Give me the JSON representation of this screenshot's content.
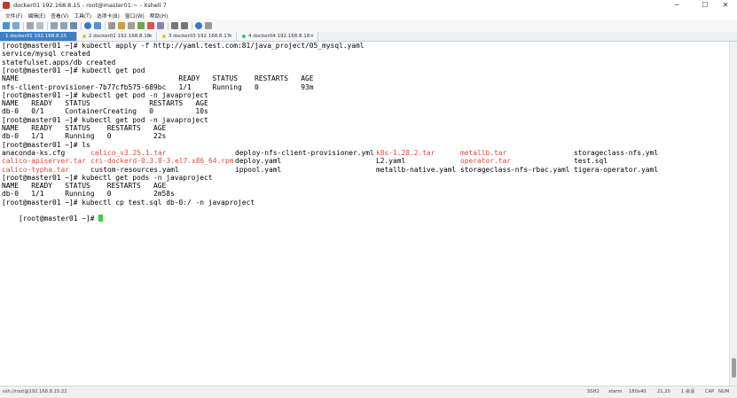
{
  "window": {
    "title": "docker01 192.168.8.15 - root@master01:~ - Xshell 7",
    "minimize": "─",
    "maximize": "☐",
    "close": "✕"
  },
  "menu": [
    "文件(F)",
    "编辑(E)",
    "查看(V)",
    "工具(T)",
    "选项卡(B)",
    "窗口(W)",
    "帮助(H)"
  ],
  "tabs": [
    {
      "label": "1 docker01 192.168.8.15",
      "dot": "#2ecc71"
    },
    {
      "label": "2 docker02 192.168.8.16",
      "dot": "#f1c40f"
    },
    {
      "label": "3 docker03 192.168.8.17",
      "dot": "#f1c40f"
    },
    {
      "label": "4 docker04 192.168.8.18",
      "dot": "#2ecc71"
    }
  ],
  "tab_close": "×",
  "terminal": {
    "lines": [
      "[root@master01 ~]# kubectl apply -f http://yaml.test.com:81/java_project/05_mysql.yaml",
      "service/mysql created",
      "statefulset.apps/db created",
      "[root@master01 ~]# kubectl get pod",
      "NAME                                      READY   STATUS    RESTARTS   AGE",
      "nfs-client-provisioner-7b77cfb575-689bc   1/1     Running   0          93m",
      "[root@master01 ~]# kubectl get pod -n javaproject",
      "NAME   READY   STATUS              RESTARTS   AGE",
      "db-0   0/1     ContainerCreating   0          10s",
      "[root@master01 ~]# kubectl get pod -n javaproject",
      "NAME   READY   STATUS    RESTARTS   AGE",
      "db-0   1/1     Running   0          22s",
      "[root@master01 ~]# ls",
      "",
      "",
      "",
      "[root@master01 ~]# kubectl get pods -n javaproject",
      "NAME   READY   STATUS    RESTARTS   AGE",
      "db-0   1/1     Running   0          2m58s",
      "[root@master01 ~]# kubectl cp test.sql db-0:/ -n javaproject",
      "[root@master01 ~]# "
    ],
    "ls_rows": [
      [
        {
          "text": "anaconda-ks.cfg",
          "red": false
        },
        {
          "text": "calico_v3.25.1.tar",
          "red": true
        },
        {
          "text": "deploy-nfs-client-provisioner.yml",
          "red": false
        },
        {
          "text": "k8s-1.28.2.tar",
          "red": true
        },
        {
          "text": "metallb.tar",
          "red": true
        },
        {
          "text": "storageclass-nfs.yml",
          "red": false
        }
      ],
      [
        {
          "text": "calico-apiserver.tar",
          "red": true
        },
        {
          "text": "cri-dockerd-0.3.8-3.el7.x86_64.rpm",
          "red": true
        },
        {
          "text": "deploy.yaml",
          "red": false
        },
        {
          "text": "L2.yaml",
          "red": false
        },
        {
          "text": "operator.tar",
          "red": true
        },
        {
          "text": "test.sql",
          "red": false
        }
      ],
      [
        {
          "text": "calico-typha.tar",
          "red": true
        },
        {
          "text": "custom-resources.yaml",
          "red": false
        },
        {
          "text": "ippool.yaml",
          "red": false
        },
        {
          "text": "metallb-native.yaml",
          "red": false
        },
        {
          "text": "storageclass-nfs-rbac.yaml",
          "red": false
        },
        {
          "text": "tigera-operator.yaml",
          "red": false
        }
      ]
    ],
    "cursor_color": "#3cd13c"
  },
  "status": {
    "connection": "ssh://root@192.168.8.15:22",
    "protocol": "SSH2",
    "term": "xterm",
    "size": "180x40",
    "position": "21,20",
    "sessions": "1 会话",
    "caps": "CAP",
    "num": "NUM"
  }
}
